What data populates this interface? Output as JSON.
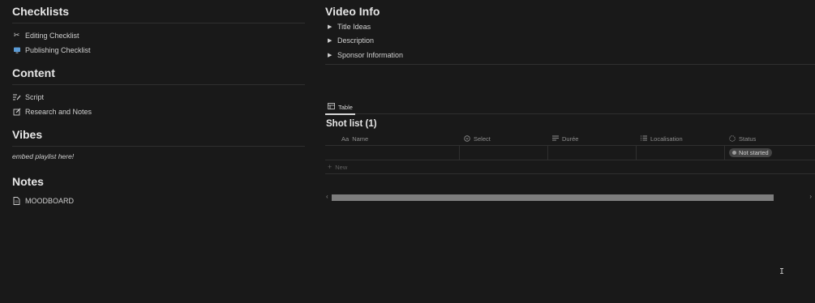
{
  "left": {
    "checklists": {
      "heading": "Checklists",
      "items": [
        {
          "label": "Editing Checklist",
          "icon": "scissors-icon"
        },
        {
          "label": "Publishing Checklist",
          "icon": "monitor-icon"
        }
      ]
    },
    "content": {
      "heading": "Content",
      "items": [
        {
          "label": "Script",
          "icon": "pen-lines-icon"
        },
        {
          "label": "Research and Notes",
          "icon": "edit-icon"
        }
      ]
    },
    "vibes": {
      "heading": "Vibes",
      "text": "embed playlist here!"
    },
    "notes": {
      "heading": "Notes",
      "items": [
        {
          "label": "MOODBOARD",
          "icon": "page-icon"
        }
      ]
    }
  },
  "right": {
    "video_info": {
      "heading": "Video Info",
      "toggles": [
        "Title Ideas",
        "Description",
        "Sponsor Information"
      ]
    },
    "view_tab": "Table",
    "database": {
      "title": "Shot list (1)",
      "columns": [
        {
          "label": "Name",
          "icon": "Aa"
        },
        {
          "label": "Select",
          "icon": "select-icon"
        },
        {
          "label": "Durée",
          "icon": "text-icon"
        },
        {
          "label": "Localisation",
          "icon": "list-icon"
        },
        {
          "label": "Status",
          "icon": "status-icon"
        }
      ],
      "rows": [
        {
          "name": "",
          "select": "",
          "duree": "",
          "localisation": "",
          "status": "Not started"
        }
      ],
      "new_label": "New"
    }
  },
  "colors": {
    "background": "#191919",
    "text": "#d4d4d4",
    "muted": "#8f8f8f",
    "divider": "#2f2f2f",
    "status_pill": "#444444"
  }
}
